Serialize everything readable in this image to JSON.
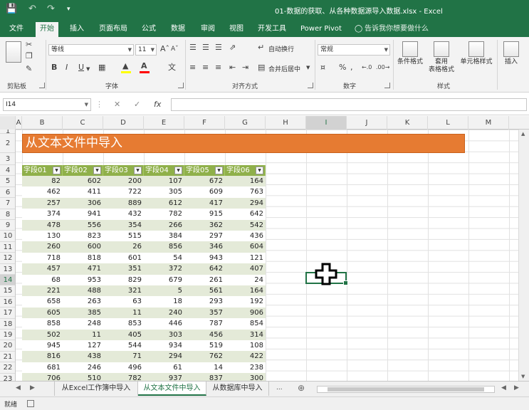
{
  "titlebar": {
    "doc_title": "01-数据的获取、从各种数据源导入数据.xlsx  -  Excel",
    "icons": [
      "save-icon",
      "undo-icon",
      "redo-icon",
      "customize-qat-icon"
    ]
  },
  "ribbon_tabs": [
    "文件",
    "开始",
    "插入",
    "页面布局",
    "公式",
    "数据",
    "审阅",
    "视图",
    "开发工具",
    "Power Pivot"
  ],
  "active_tab": "开始",
  "tell_me": "告诉我你想要做什么",
  "ribbon": {
    "clipboard": {
      "label": "剪贴板"
    },
    "font": {
      "label": "字体",
      "name": "等线",
      "size": "11",
      "bold": "B",
      "italic": "I",
      "underline": "U",
      "font_color": "#ff0000",
      "fill_color": "#ffff00"
    },
    "alignment": {
      "label": "对齐方式",
      "wrap": "自动换行",
      "merge": "合并后居中"
    },
    "number": {
      "label": "数字",
      "format": "常规",
      "percent": "%"
    },
    "styles": {
      "label": "样式",
      "conditional": "条件格式",
      "table_format_1": "套用",
      "table_format_2": "表格格式",
      "cell_styles": "单元格样式"
    },
    "cells": {
      "insert": "插入"
    }
  },
  "formula_bar": {
    "name_box": "I14",
    "fx": "fx",
    "value": ""
  },
  "columns": [
    "A",
    "B",
    "C",
    "D",
    "E",
    "F",
    "G",
    "H",
    "I",
    "J",
    "K",
    "L",
    "M"
  ],
  "selected_column": "I",
  "rows": [
    "1",
    "2",
    "3",
    "4",
    "5",
    "6",
    "7",
    "8",
    "9",
    "10",
    "11",
    "12",
    "13",
    "14",
    "15",
    "16",
    "17",
    "18",
    "19",
    "20",
    "21",
    "22",
    "23"
  ],
  "selected_row": "14",
  "banner_title": "从文本文件中导入",
  "table": {
    "headers": [
      "字段01",
      "字段02",
      "字段03",
      "字段04",
      "字段05",
      "字段06"
    ],
    "rows": [
      [
        82,
        602,
        200,
        107,
        672,
        164
      ],
      [
        462,
        411,
        722,
        305,
        609,
        763
      ],
      [
        257,
        306,
        889,
        612,
        417,
        294
      ],
      [
        374,
        941,
        432,
        782,
        915,
        642
      ],
      [
        478,
        556,
        354,
        266,
        362,
        542
      ],
      [
        130,
        823,
        515,
        384,
        297,
        436
      ],
      [
        260,
        600,
        26,
        856,
        346,
        604
      ],
      [
        718,
        818,
        601,
        54,
        943,
        121
      ],
      [
        457,
        471,
        351,
        372,
        642,
        407
      ],
      [
        68,
        953,
        829,
        679,
        261,
        24
      ],
      [
        221,
        488,
        321,
        5,
        561,
        164
      ],
      [
        658,
        263,
        63,
        18,
        293,
        192
      ],
      [
        605,
        385,
        11,
        240,
        357,
        906
      ],
      [
        858,
        248,
        853,
        446,
        787,
        854
      ],
      [
        502,
        11,
        405,
        303,
        456,
        314
      ],
      [
        945,
        127,
        544,
        934,
        519,
        108
      ],
      [
        816,
        438,
        71,
        294,
        762,
        422
      ],
      [
        681,
        246,
        496,
        61,
        14,
        238
      ],
      [
        706,
        510,
        782,
        937,
        837,
        300
      ]
    ]
  },
  "sheet_tabs": [
    "从Excel工作簿中导入",
    "从文本文件中导入",
    "从数据库中导入"
  ],
  "active_sheet": "从文本文件中导入",
  "sheet_more": "...",
  "status": "就绪",
  "colors": {
    "excel_green": "#217346",
    "banner": "#e67b32",
    "table_header": "#8fb04a",
    "band": "#e4ead8"
  }
}
